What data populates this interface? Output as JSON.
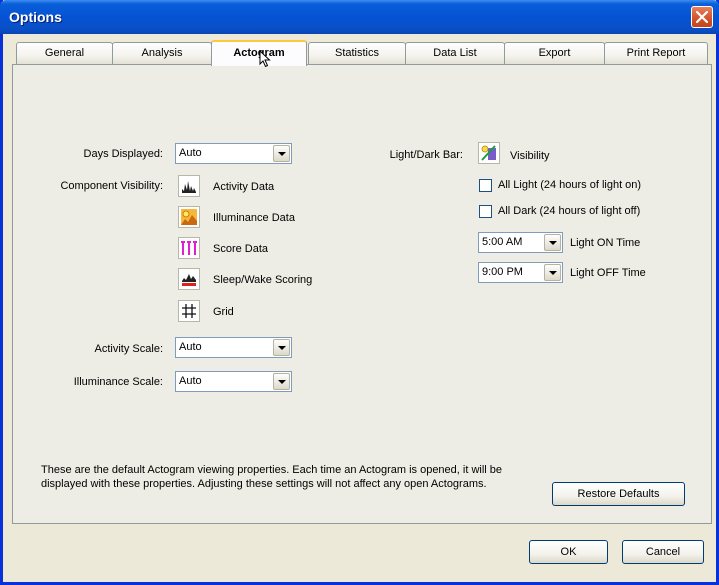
{
  "window": {
    "title": "Options"
  },
  "tabs": [
    {
      "label": "General"
    },
    {
      "label": "Analysis"
    },
    {
      "label": "Actogram"
    },
    {
      "label": "Statistics"
    },
    {
      "label": "Data List"
    },
    {
      "label": "Export"
    },
    {
      "label": "Print Report"
    }
  ],
  "left": {
    "days_displayed_label": "Days Displayed:",
    "days_displayed_value": "Auto",
    "component_visibility_label": "Component Visibility:",
    "components": [
      {
        "icon": "activity-data-icon",
        "label": "Activity Data"
      },
      {
        "icon": "illuminance-data-icon",
        "label": "Illuminance Data"
      },
      {
        "icon": "score-data-icon",
        "label": "Score Data"
      },
      {
        "icon": "sleep-wake-scoring-icon",
        "label": "Sleep/Wake Scoring"
      },
      {
        "icon": "grid-icon",
        "label": "Grid"
      }
    ],
    "activity_scale_label": "Activity Scale:",
    "activity_scale_value": "Auto",
    "illuminance_scale_label": "Illuminance Scale:",
    "illuminance_scale_value": "Auto"
  },
  "right": {
    "light_dark_bar_label": "Light/Dark Bar:",
    "visibility_label": "Visibility",
    "all_light_label": "All Light (24 hours of light on)",
    "all_dark_label": "All Dark (24 hours of light off)",
    "light_on_value": "5:00 AM",
    "light_on_label": "Light ON Time",
    "light_off_value": "9:00 PM",
    "light_off_label": "Light OFF Time"
  },
  "footer": {
    "description": "These are the default Actogram viewing properties. Each time an Actogram is opened, it will be displayed with these properties. Adjusting these settings will not affect any open Actograms.",
    "restore_defaults_label": "Restore Defaults",
    "ok_label": "OK",
    "cancel_label": "Cancel"
  }
}
